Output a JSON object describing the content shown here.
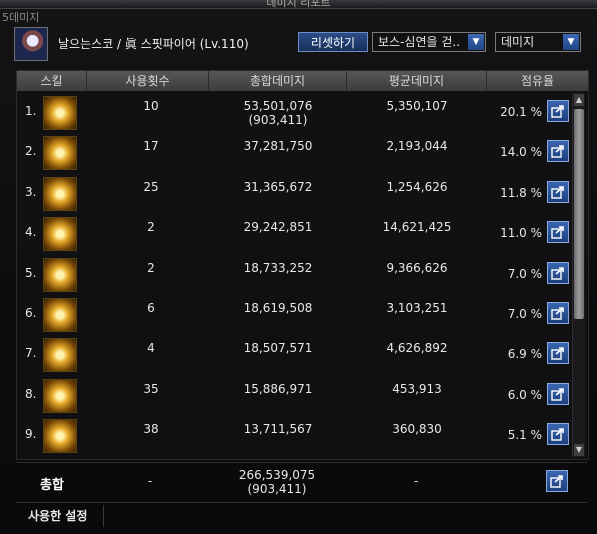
{
  "window": {
    "title": "데미지 리포트",
    "side_label": "5데미지"
  },
  "header": {
    "character": "날으는스코 / 眞 스핏파이어 (Lv.110)",
    "reset_label": "리셋하기",
    "boss_select": "보스-심연을 걷..",
    "metric_select": "데미지"
  },
  "table": {
    "headers": [
      "스킬",
      "사용횟수",
      "총합데미지",
      "평균데미지",
      "점유율"
    ],
    "rows": [
      {
        "num": "1.",
        "uses": "10",
        "total": "53,501,076",
        "total_sub": "(903,411)",
        "avg": "5,350,107",
        "pct": "20.1 %"
      },
      {
        "num": "2.",
        "uses": "17",
        "total": "37,281,750",
        "total_sub": "",
        "avg": "2,193,044",
        "pct": "14.0 %"
      },
      {
        "num": "3.",
        "uses": "25",
        "total": "31,365,672",
        "total_sub": "",
        "avg": "1,254,626",
        "pct": "11.8 %"
      },
      {
        "num": "4.",
        "uses": "2",
        "total": "29,242,851",
        "total_sub": "",
        "avg": "14,621,425",
        "pct": "11.0 %"
      },
      {
        "num": "5.",
        "uses": "2",
        "total": "18,733,252",
        "total_sub": "",
        "avg": "9,366,626",
        "pct": "7.0 %"
      },
      {
        "num": "6.",
        "uses": "6",
        "total": "18,619,508",
        "total_sub": "",
        "avg": "3,103,251",
        "pct": "7.0 %"
      },
      {
        "num": "7.",
        "uses": "4",
        "total": "18,507,571",
        "total_sub": "",
        "avg": "4,626,892",
        "pct": "6.9 %"
      },
      {
        "num": "8.",
        "uses": "35",
        "total": "15,886,971",
        "total_sub": "",
        "avg": "453,913",
        "pct": "6.0 %"
      },
      {
        "num": "9.",
        "uses": "38",
        "total": "13,711,567",
        "total_sub": "",
        "avg": "360,830",
        "pct": "5.1 %"
      }
    ]
  },
  "summary": {
    "label": "총합",
    "uses": "-",
    "total": "266,539,075",
    "total_sub": "(903,411)",
    "avg": "-"
  },
  "footer": {
    "tab_label": "사용한 설정"
  },
  "colors": {
    "accent": "#2d5aa8",
    "header_bg": "#4a4a4a",
    "icon_gold": "#e4a92a"
  }
}
